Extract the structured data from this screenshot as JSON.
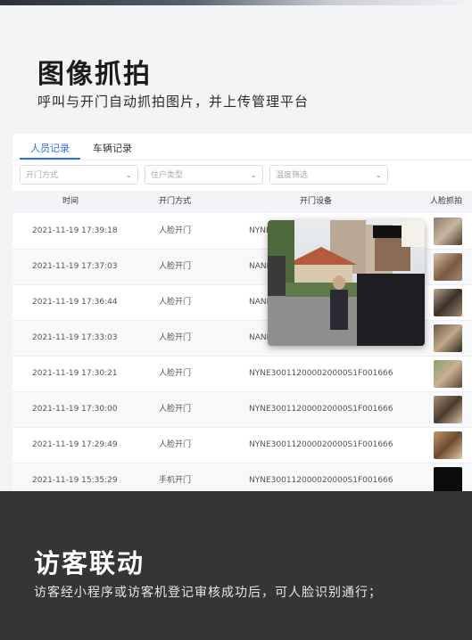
{
  "hero": {
    "title": "图像抓拍",
    "subtitle": "呼叫与开门自动抓拍图片，并上传管理平台"
  },
  "tabs": [
    {
      "label": "人员记录",
      "active": true
    },
    {
      "label": "车辆记录",
      "active": false
    }
  ],
  "filters": [
    {
      "placeholder": "开门方式"
    },
    {
      "placeholder": "住户类型"
    },
    {
      "placeholder": "温度筛选"
    }
  ],
  "table": {
    "columns": [
      "时间",
      "开门方式",
      "开门设备",
      "人脸抓拍"
    ],
    "rows": [
      {
        "time": "2021-11-19 17:39:18",
        "method": "人脸开门",
        "device": "NYNE"
      },
      {
        "time": "2021-11-19 17:37:03",
        "method": "人脸开门",
        "device": "NANE"
      },
      {
        "time": "2021-11-19 17:36:44",
        "method": "人脸开门",
        "device": "NANE"
      },
      {
        "time": "2021-11-19 17:33:03",
        "method": "人脸开门",
        "device": "NANE"
      },
      {
        "time": "2021-11-19 17:30:21",
        "method": "人脸开门",
        "device": "NYNE300112000020000S1F001666"
      },
      {
        "time": "2021-11-19 17:30:00",
        "method": "人脸开门",
        "device": "NYNE300112000020000S1F001666"
      },
      {
        "time": "2021-11-19 17:29:49",
        "method": "人脸开门",
        "device": "NYNE300112000020000S1F001666"
      },
      {
        "time": "2021-11-19 15:35:29",
        "method": "手机开门",
        "device": "NYNE300112000020000S1F001666"
      }
    ]
  },
  "bottom": {
    "title": "访客联动",
    "subtitle": "访客经小程序或访客机登记审核成功后，可人脸识别通行；"
  },
  "colors": {
    "accent": "#2f6fe0",
    "bottom_bg": "#353535"
  }
}
